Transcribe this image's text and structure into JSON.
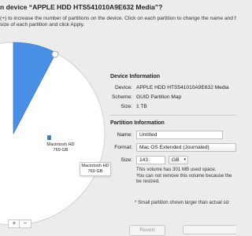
{
  "dialog": {
    "title": "n device “APPLE HDD HTS541010A9E632 Media”?",
    "instructions": "(+) to increase the number of partitions on the device. Click on each partition to change the name and form\nsize of each partition and click Apply."
  },
  "pie": {
    "partition_label": "Macintosh HD",
    "partition_size": "769 GB",
    "tooltip_name": "Macintosh HD",
    "tooltip_size": "769 GB",
    "add_label": "+",
    "remove_label": "−",
    "colors": {
      "free_space": "#ffffff",
      "new_partition": "#4a8fe6"
    }
  },
  "device_info": {
    "heading": "Device Information",
    "device_label": "Device:",
    "device_value": "APPLE HDD HTS541010A9E632 Media",
    "scheme_label": "Scheme:",
    "scheme_value": "GUID Partition Map",
    "size_label": "Size:",
    "size_value": "1 TB"
  },
  "partition_info": {
    "heading": "Partition Information",
    "name_label": "Name:",
    "name_value": "Untitled",
    "format_label": "Format:",
    "format_value": "Mac OS Extended (Journaled)",
    "size_label": "Size:",
    "size_value": "143",
    "size_unit": "GB",
    "note": "This volume has 301 MB used space.\nYou can not remove this volume because the\nbe resized.",
    "footnote": "* Small partition shown larger than actual siz"
  },
  "buttons": {
    "revert": "Revert"
  }
}
